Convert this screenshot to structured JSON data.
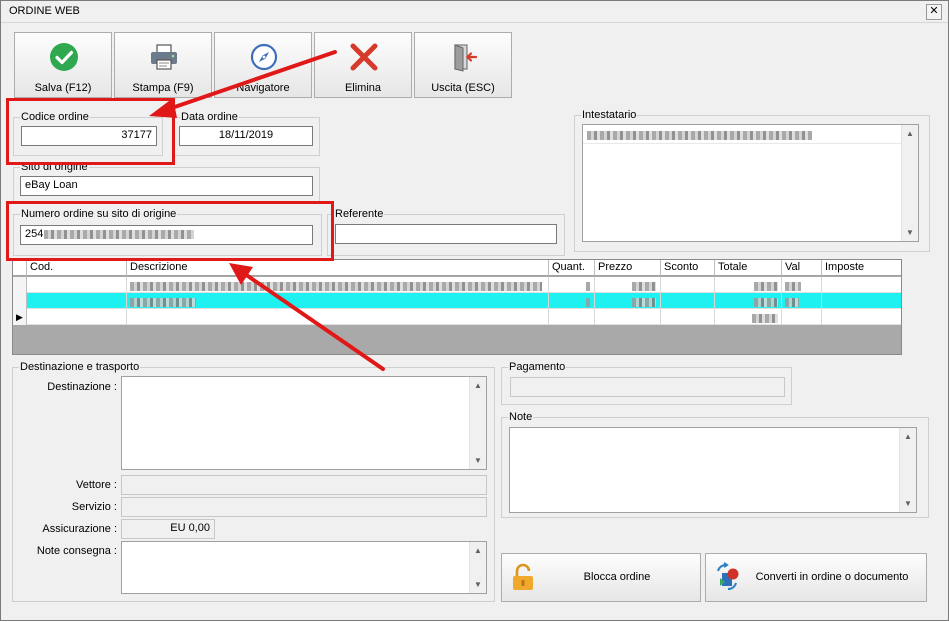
{
  "window": {
    "title": "ORDINE WEB",
    "close_glyph": "✕"
  },
  "toolbar": [
    {
      "label": "Salva (F12)",
      "icon": "check-circle-icon"
    },
    {
      "label": "Stampa (F9)",
      "icon": "printer-icon"
    },
    {
      "label": "Navigatore",
      "icon": "compass-icon"
    },
    {
      "label": "Elimina",
      "icon": "delete-x-icon"
    },
    {
      "label": "Uscita (ESC)",
      "icon": "exit-door-icon"
    }
  ],
  "codice_ordine": {
    "label": "Codice ordine",
    "value": "37177"
  },
  "data_ordine": {
    "label": "Data ordine",
    "value": "18/11/2019"
  },
  "sito_origine": {
    "label": "Sito di origine",
    "value": "eBay Loan"
  },
  "numero_ordine": {
    "label": "Numero ordine su sito di origine",
    "value": "254"
  },
  "referente": {
    "label": "Referente",
    "value": ""
  },
  "intestatario": {
    "label": "Intestatario"
  },
  "grid": {
    "columns": [
      "Cod.",
      "Descrizione",
      "Quant.",
      "Prezzo",
      "Sconto",
      "Totale",
      "Val",
      "Imposte"
    ],
    "row_marker": "▶"
  },
  "destinazione": {
    "group_label": "Destinazione e trasporto",
    "destinazione_label": "Destinazione :",
    "vettore_label": "Vettore :",
    "servizio_label": "Servizio :",
    "assicurazione_label": "Assicurazione :",
    "assicurazione_value": "EU 0,00",
    "note_consegna_label": "Note consegna :"
  },
  "pagamento": {
    "label": "Pagamento"
  },
  "note": {
    "label": "Note"
  },
  "actions": {
    "blocca_label": "Blocca ordine",
    "converti_label": "Converti in ordine o documento"
  },
  "scroll": {
    "up": "▲",
    "down": "▼"
  },
  "colors": {
    "accent_red": "#e01818",
    "selected_row": "#1ff0f0",
    "save_green": "#2fa84f"
  }
}
